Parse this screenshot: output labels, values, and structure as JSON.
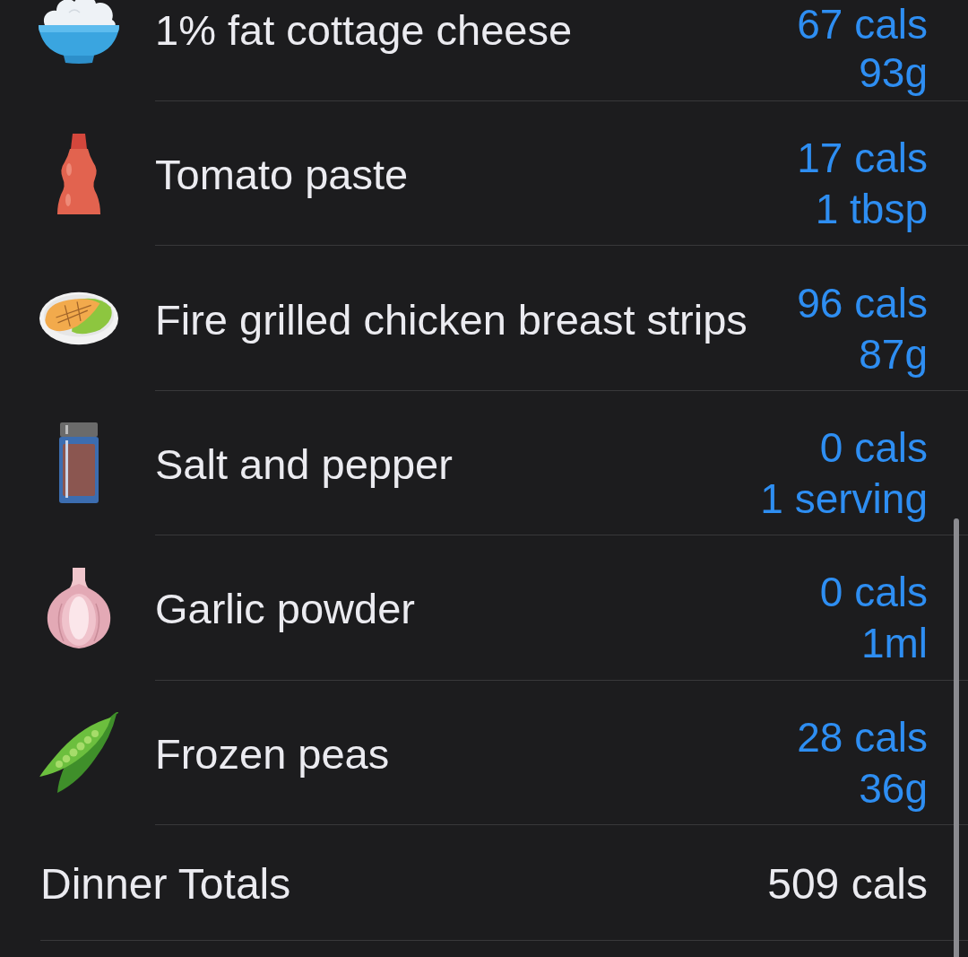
{
  "food_items": [
    {
      "kind": "bowl",
      "name": "1% fat cottage cheese",
      "calories": "67 cals",
      "amount": "93g"
    },
    {
      "kind": "bottle",
      "name": "Tomato paste",
      "calories": "17 cals",
      "amount": "1 tbsp"
    },
    {
      "kind": "plate",
      "name": "Fire grilled chicken breast strips",
      "calories": "96 cals",
      "amount": "87g"
    },
    {
      "kind": "jar",
      "name": "Salt and pepper",
      "calories": "0 cals",
      "amount": "1 serving"
    },
    {
      "kind": "garlic",
      "name": "Garlic powder",
      "calories": "0 cals",
      "amount": "1ml"
    },
    {
      "kind": "peapod",
      "name": "Frozen peas",
      "calories": "28 cals",
      "amount": "36g"
    }
  ],
  "totals": {
    "label": "Dinner Totals",
    "calories": "509 cals"
  }
}
